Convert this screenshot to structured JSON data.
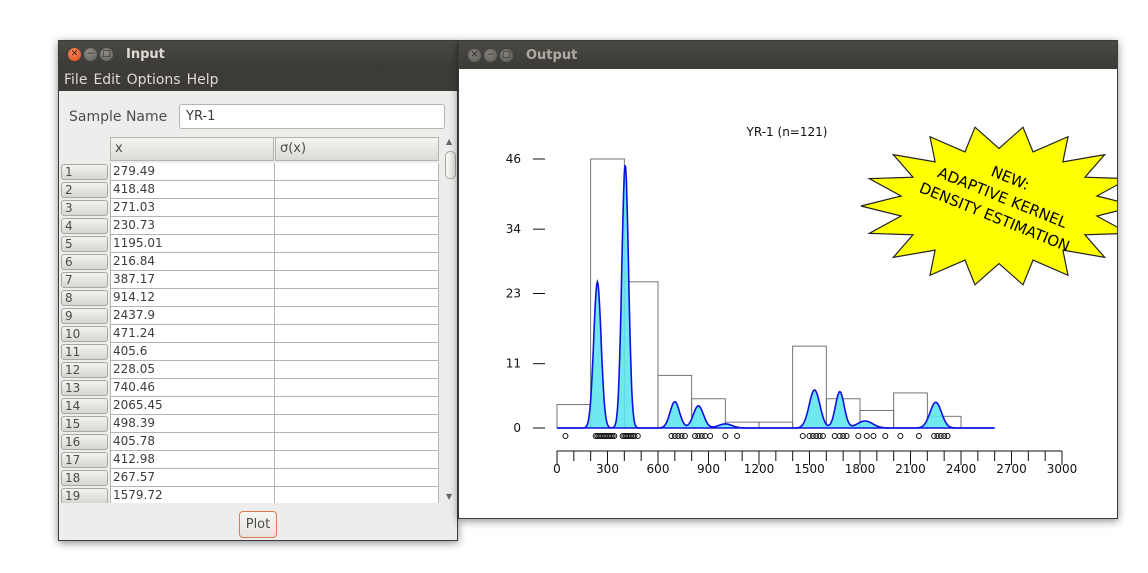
{
  "input_window": {
    "title": "Input",
    "menu": [
      "File",
      "Edit",
      "Options",
      "Help"
    ],
    "sample_name_label": "Sample Name",
    "sample_name_value": "YR-1",
    "columns": [
      "x",
      "σ(x)"
    ],
    "rows": [
      {
        "n": "1",
        "x": "279.49",
        "sx": ""
      },
      {
        "n": "2",
        "x": "418.48",
        "sx": ""
      },
      {
        "n": "3",
        "x": "271.03",
        "sx": ""
      },
      {
        "n": "4",
        "x": "230.73",
        "sx": ""
      },
      {
        "n": "5",
        "x": "1195.01",
        "sx": ""
      },
      {
        "n": "6",
        "x": "216.84",
        "sx": ""
      },
      {
        "n": "7",
        "x": "387.17",
        "sx": ""
      },
      {
        "n": "8",
        "x": "914.12",
        "sx": ""
      },
      {
        "n": "9",
        "x": "2437.9",
        "sx": ""
      },
      {
        "n": "10",
        "x": "471.24",
        "sx": ""
      },
      {
        "n": "11",
        "x": "405.6",
        "sx": ""
      },
      {
        "n": "12",
        "x": "228.05",
        "sx": ""
      },
      {
        "n": "13",
        "x": "740.46",
        "sx": ""
      },
      {
        "n": "14",
        "x": "2065.45",
        "sx": ""
      },
      {
        "n": "15",
        "x": "498.39",
        "sx": ""
      },
      {
        "n": "16",
        "x": "405.78",
        "sx": ""
      },
      {
        "n": "17",
        "x": "412.98",
        "sx": ""
      },
      {
        "n": "18",
        "x": "267.57",
        "sx": ""
      },
      {
        "n": "19",
        "x": "1579.72",
        "sx": ""
      }
    ],
    "plot_button": "Plot"
  },
  "output_window": {
    "title": "Output",
    "callout": [
      "NEW:",
      "ADAPTIVE KERNEL",
      "DENSITY ESTIMATION"
    ]
  },
  "colors": {
    "kde_line": "#1010e0",
    "kde_fill": "#5fe6ee",
    "callout_fill": "#ffff00",
    "close_button": "#e8551f"
  },
  "chart_data": {
    "type": "bar",
    "title": "YR-1 (n=121)",
    "xlim": [
      0,
      3000
    ],
    "x_ticks": [
      0,
      300,
      600,
      900,
      1200,
      1500,
      1800,
      2100,
      2400,
      2700,
      3000
    ],
    "y_ticks": [
      0,
      11,
      23,
      34,
      46
    ],
    "ylim": [
      0,
      46
    ],
    "histogram_bins": [
      {
        "from": 0,
        "to": 200,
        "count": 4
      },
      {
        "from": 200,
        "to": 400,
        "count": 46
      },
      {
        "from": 400,
        "to": 600,
        "count": 25
      },
      {
        "from": 600,
        "to": 800,
        "count": 9
      },
      {
        "from": 800,
        "to": 1000,
        "count": 5
      },
      {
        "from": 1000,
        "to": 1200,
        "count": 1
      },
      {
        "from": 1200,
        "to": 1400,
        "count": 1
      },
      {
        "from": 1400,
        "to": 1600,
        "count": 14
      },
      {
        "from": 1600,
        "to": 1800,
        "count": 5
      },
      {
        "from": 1800,
        "to": 2000,
        "count": 3
      },
      {
        "from": 2000,
        "to": 2200,
        "count": 6
      },
      {
        "from": 2200,
        "to": 2400,
        "count": 2
      }
    ],
    "kde_peaks": [
      {
        "x": 240,
        "height": 25,
        "width": 22
      },
      {
        "x": 405,
        "height": 45,
        "width": 20
      },
      {
        "x": 700,
        "height": 4.5,
        "width": 28
      },
      {
        "x": 840,
        "height": 3.8,
        "width": 30
      },
      {
        "x": 1000,
        "height": 0.7,
        "width": 40
      },
      {
        "x": 1530,
        "height": 6.5,
        "width": 32
      },
      {
        "x": 1680,
        "height": 6.2,
        "width": 26
      },
      {
        "x": 1830,
        "height": 1.2,
        "width": 45
      },
      {
        "x": 2250,
        "height": 4.4,
        "width": 34
      }
    ],
    "samples": [
      50,
      230,
      240,
      250,
      260,
      270,
      280,
      290,
      300,
      310,
      320,
      330,
      340,
      390,
      400,
      410,
      420,
      430,
      440,
      450,
      460,
      480,
      680,
      700,
      720,
      740,
      760,
      820,
      840,
      860,
      880,
      910,
      1000,
      1070,
      1460,
      1500,
      1520,
      1540,
      1560,
      1580,
      1650,
      1680,
      1700,
      1720,
      1790,
      1840,
      1880,
      1950,
      2040,
      2150,
      2240,
      2260,
      2280,
      2300,
      2320
    ]
  }
}
